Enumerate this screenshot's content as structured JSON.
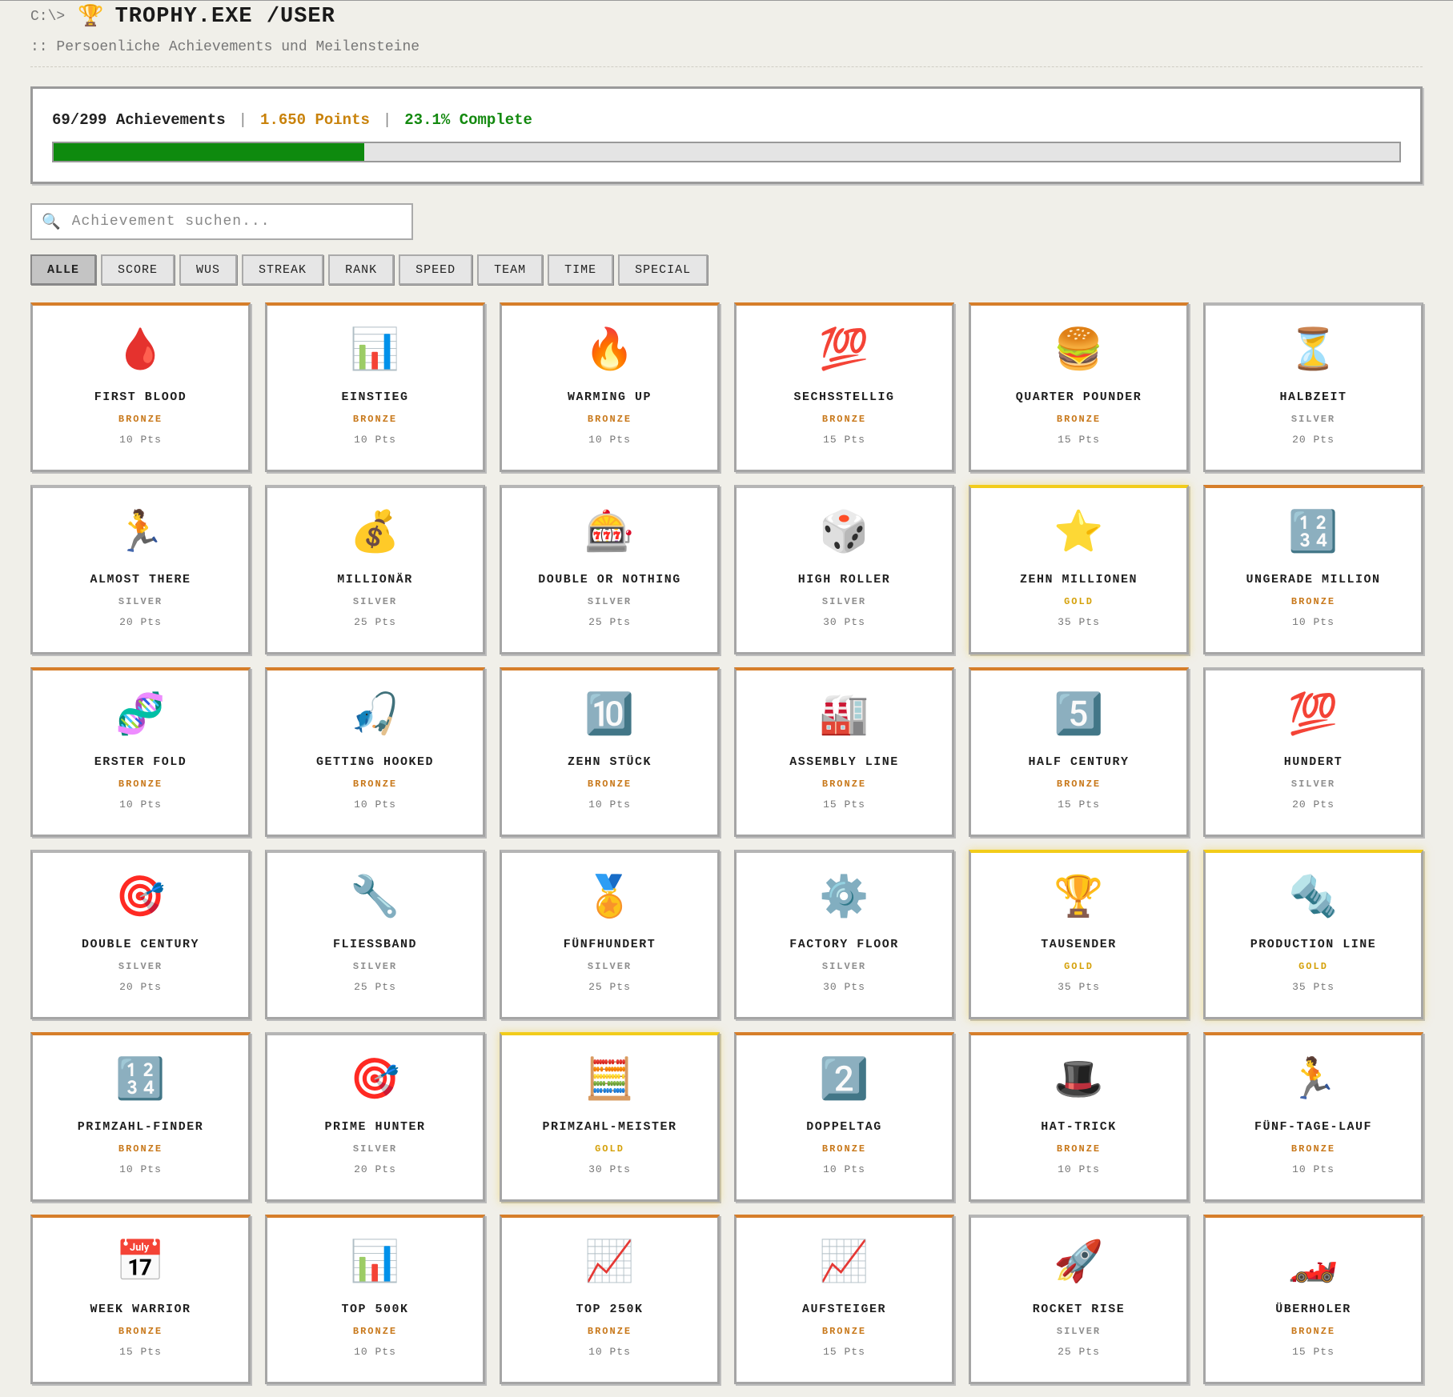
{
  "header": {
    "prompt": "C:\\>",
    "logo_icon": "🏆",
    "title": "TROPHY.EXE /USER",
    "subtitle": ":: Persoenliche Achievements und Meilensteine"
  },
  "stats": {
    "achievements": "69/299 Achievements",
    "separator": "|",
    "points": "1.650 Points",
    "complete": "23.1% Complete",
    "progress_fraction": 0.231
  },
  "search": {
    "icon": "search-icon",
    "placeholder": "Achievement suchen..."
  },
  "filters": [
    "ALLE",
    "SCORE",
    "WUS",
    "STREAK",
    "RANK",
    "SPEED",
    "TEAM",
    "TIME",
    "SPECIAL"
  ],
  "active_filter": "ALLE",
  "colors": {
    "bronze": "#d67e2a",
    "silver": "#b5b5b5",
    "gold": "#f2cc1a",
    "progress": "#0e8a0e",
    "points": "#c9820a",
    "complete": "#13890f"
  },
  "achievements": [
    {
      "icon": "🩸",
      "icon_name": "blood-drop-icon",
      "name": "FIRST BLOOD",
      "tier": "BRONZE",
      "points": "10 Pts"
    },
    {
      "icon": "📊",
      "icon_name": "bar-chart-icon",
      "name": "EINSTIEG",
      "tier": "BRONZE",
      "points": "10 Pts"
    },
    {
      "icon": "🔥",
      "icon_name": "fire-icon",
      "name": "WARMING UP",
      "tier": "BRONZE",
      "points": "10 Pts"
    },
    {
      "icon": "💯",
      "icon_name": "hundred-points-icon",
      "name": "SECHSSTELLIG",
      "tier": "BRONZE",
      "points": "15 Pts"
    },
    {
      "icon": "🍔",
      "icon_name": "burger-icon",
      "name": "QUARTER POUNDER",
      "tier": "BRONZE",
      "points": "15 Pts"
    },
    {
      "icon": "⏳",
      "icon_name": "hourglass-icon",
      "name": "HALBZEIT",
      "tier": "SILVER",
      "points": "20 Pts"
    },
    {
      "icon": "🏃",
      "icon_name": "runner-icon",
      "name": "ALMOST THERE",
      "tier": "SILVER",
      "points": "20 Pts"
    },
    {
      "icon": "💰",
      "icon_name": "money-bag-icon",
      "name": "MILLIONÄR",
      "tier": "SILVER",
      "points": "25 Pts"
    },
    {
      "icon": "🎰",
      "icon_name": "slot-machine-icon",
      "name": "DOUBLE OR NOTHING",
      "tier": "SILVER",
      "points": "25 Pts"
    },
    {
      "icon": "🎲",
      "icon_name": "dice-icon",
      "name": "HIGH ROLLER",
      "tier": "SILVER",
      "points": "30 Pts"
    },
    {
      "icon": "⭐",
      "icon_name": "star-icon",
      "name": "ZEHN MILLIONEN",
      "tier": "GOLD",
      "points": "35 Pts"
    },
    {
      "icon": "🔢",
      "icon_name": "numbers-icon",
      "name": "UNGERADE MILLION",
      "tier": "BRONZE",
      "points": "10 Pts"
    },
    {
      "icon": "🧬",
      "icon_name": "dna-icon",
      "name": "ERSTER FOLD",
      "tier": "BRONZE",
      "points": "10 Pts"
    },
    {
      "icon": "🎣",
      "icon_name": "fishing-hook-icon",
      "name": "GETTING HOOKED",
      "tier": "BRONZE",
      "points": "10 Pts"
    },
    {
      "icon": "🔟",
      "icon_name": "keycap-ten-icon",
      "name": "ZEHN STÜCK",
      "tier": "BRONZE",
      "points": "10 Pts"
    },
    {
      "icon": "🏭",
      "icon_name": "factory-icon",
      "name": "ASSEMBLY LINE",
      "tier": "BRONZE",
      "points": "15 Pts"
    },
    {
      "icon": "5️⃣",
      "icon_name": "keycap-five-icon",
      "name": "HALF CENTURY",
      "tier": "BRONZE",
      "points": "15 Pts"
    },
    {
      "icon": "💯",
      "icon_name": "hundred-points-icon",
      "name": "HUNDERT",
      "tier": "SILVER",
      "points": "20 Pts"
    },
    {
      "icon": "🎯",
      "icon_name": "target-icon",
      "name": "DOUBLE CENTURY",
      "tier": "SILVER",
      "points": "20 Pts"
    },
    {
      "icon": "🔧",
      "icon_name": "wrench-icon",
      "name": "FLIESSBAND",
      "tier": "SILVER",
      "points": "25 Pts"
    },
    {
      "icon": "🏅",
      "icon_name": "medal-icon",
      "name": "FÜNFHUNDERT",
      "tier": "SILVER",
      "points": "25 Pts"
    },
    {
      "icon": "⚙️",
      "icon_name": "gear-icon",
      "name": "FACTORY FLOOR",
      "tier": "SILVER",
      "points": "30 Pts"
    },
    {
      "icon": "🏆",
      "icon_name": "trophy-icon",
      "name": "TAUSENDER",
      "tier": "GOLD",
      "points": "35 Pts"
    },
    {
      "icon": "🔩",
      "icon_name": "nut-and-bolt-icon",
      "name": "PRODUCTION LINE",
      "tier": "GOLD",
      "points": "35 Pts"
    },
    {
      "icon": "🔢",
      "icon_name": "numbers-icon",
      "name": "PRIMZAHL-FINDER",
      "tier": "BRONZE",
      "points": "10 Pts"
    },
    {
      "icon": "🎯",
      "icon_name": "target-icon",
      "name": "PRIME HUNTER",
      "tier": "SILVER",
      "points": "20 Pts"
    },
    {
      "icon": "🧮",
      "icon_name": "abacus-icon",
      "name": "PRIMZAHL-MEISTER",
      "tier": "GOLD",
      "points": "30 Pts"
    },
    {
      "icon": "2️⃣",
      "icon_name": "keycap-two-icon",
      "name": "DOPPELTAG",
      "tier": "BRONZE",
      "points": "10 Pts"
    },
    {
      "icon": "🎩",
      "icon_name": "top-hat-icon",
      "name": "HAT-TRICK",
      "tier": "BRONZE",
      "points": "10 Pts"
    },
    {
      "icon": "🏃",
      "icon_name": "runner-icon",
      "name": "FÜNF-TAGE-LAUF",
      "tier": "BRONZE",
      "points": "10 Pts"
    },
    {
      "icon": "📅",
      "icon_name": "calendar-icon",
      "name": "WEEK WARRIOR",
      "tier": "BRONZE",
      "points": "15 Pts"
    },
    {
      "icon": "📊",
      "icon_name": "bar-chart-icon",
      "name": "TOP 500K",
      "tier": "BRONZE",
      "points": "10 Pts"
    },
    {
      "icon": "📈",
      "icon_name": "chart-increasing-icon",
      "name": "TOP 250K",
      "tier": "BRONZE",
      "points": "10 Pts"
    },
    {
      "icon": "📈",
      "icon_name": "chart-increasing-icon",
      "name": "AUFSTEIGER",
      "tier": "BRONZE",
      "points": "15 Pts"
    },
    {
      "icon": "🚀",
      "icon_name": "rocket-icon",
      "name": "ROCKET RISE",
      "tier": "SILVER",
      "points": "25 Pts"
    },
    {
      "icon": "🏎️",
      "icon_name": "race-car-icon",
      "name": "ÜBERHOLER",
      "tier": "BRONZE",
      "points": "15 Pts"
    }
  ]
}
